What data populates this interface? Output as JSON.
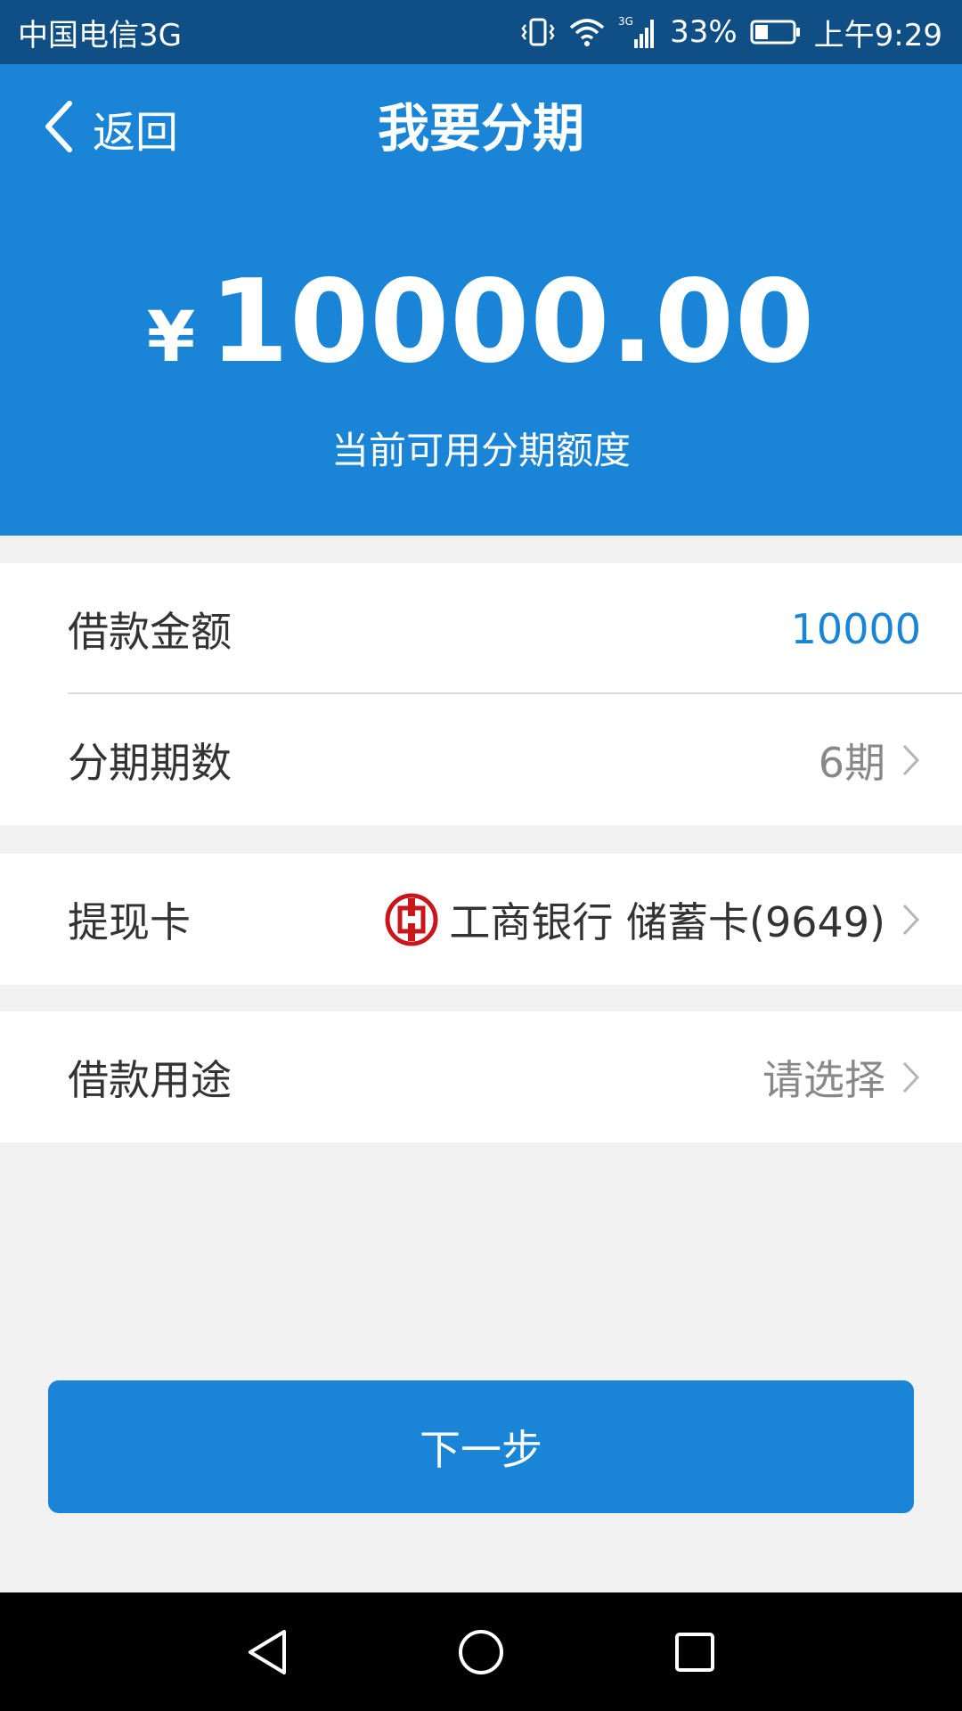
{
  "status_bar": {
    "carrier": "中国电信3G",
    "network_tag": "3G",
    "battery": "33%",
    "time": "上午9:29"
  },
  "header": {
    "back_label": "返回",
    "title": "我要分期",
    "currency_symbol": "¥",
    "available_amount": "10000.00",
    "caption": "当前可用分期额度"
  },
  "form": {
    "loan_amount": {
      "label": "借款金额",
      "value": "10000"
    },
    "installments": {
      "label": "分期期数",
      "value": "6期"
    },
    "card": {
      "label": "提现卡",
      "value": "工商银行 储蓄卡(9649)"
    },
    "purpose": {
      "label": "借款用途",
      "value": "请选择"
    }
  },
  "actions": {
    "next_label": "下一步"
  },
  "colors": {
    "status_bar": "#104f85",
    "primary": "#1a85d6",
    "bank_red": "#c8161d",
    "background": "#f2f2f2"
  },
  "icons": [
    "vibrate-icon",
    "wifi-icon",
    "signal-icon",
    "battery-icon",
    "back-chevron-icon",
    "chevron-right-icon",
    "icbc-logo-icon",
    "nav-back-icon",
    "nav-home-icon",
    "nav-recents-icon"
  ]
}
